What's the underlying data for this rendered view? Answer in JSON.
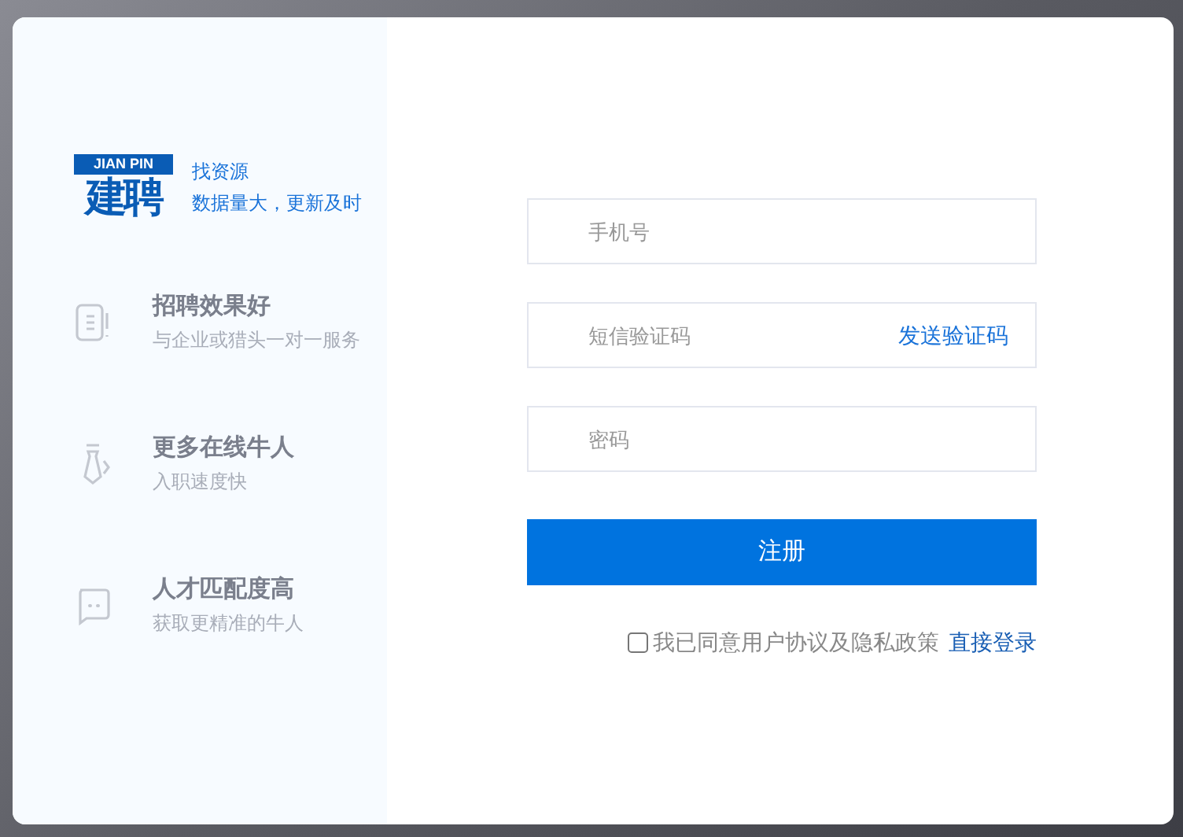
{
  "logo": {
    "top": "JIAN PIN",
    "bottom": "建聘"
  },
  "tagline": [
    "找资源",
    "数据量大，更新及时"
  ],
  "features": [
    {
      "title": "招聘效果好",
      "subtitle": "与企业或猎头一对一服务"
    },
    {
      "title": "更多在线牛人",
      "subtitle": "入职速度快"
    },
    {
      "title": "人才匹配度高",
      "subtitle": "获取更精准的牛人"
    }
  ],
  "form": {
    "phone": {
      "placeholder": "手机号"
    },
    "sms_code": {
      "placeholder": "短信验证码",
      "action": "发送验证码"
    },
    "password": {
      "placeholder": "密码"
    },
    "submit": "注册",
    "agreement": {
      "checked": false,
      "label": "我已同意用户协议及隐私政策"
    },
    "login_link": "直接登录"
  }
}
